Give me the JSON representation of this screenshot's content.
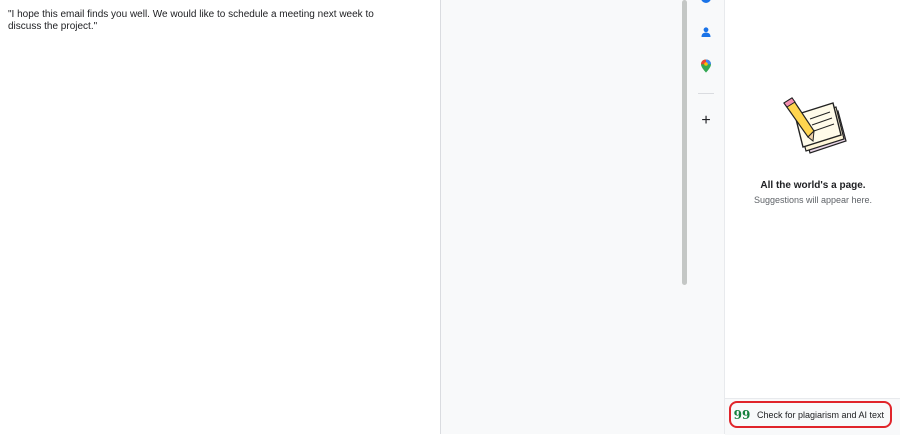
{
  "document": {
    "body_text": "\"I hope this email finds you well. We would like to schedule a meeting next week to discuss the project.\""
  },
  "side_rail": {
    "icons": [
      "contacts-icon",
      "maps-icon",
      "add-icon"
    ],
    "add_glyph": "+"
  },
  "suggestions_panel": {
    "illustration": "notepad-pencil-icon",
    "title": "All the world's a page.",
    "subtitle": "Suggestions will appear here.",
    "plagiarism_button": {
      "label": "Check for plagiarism and AI text",
      "icon_glyph": "99",
      "icon_color": "#15803d"
    }
  },
  "annotation": {
    "highlight_color": "#e0242a"
  }
}
